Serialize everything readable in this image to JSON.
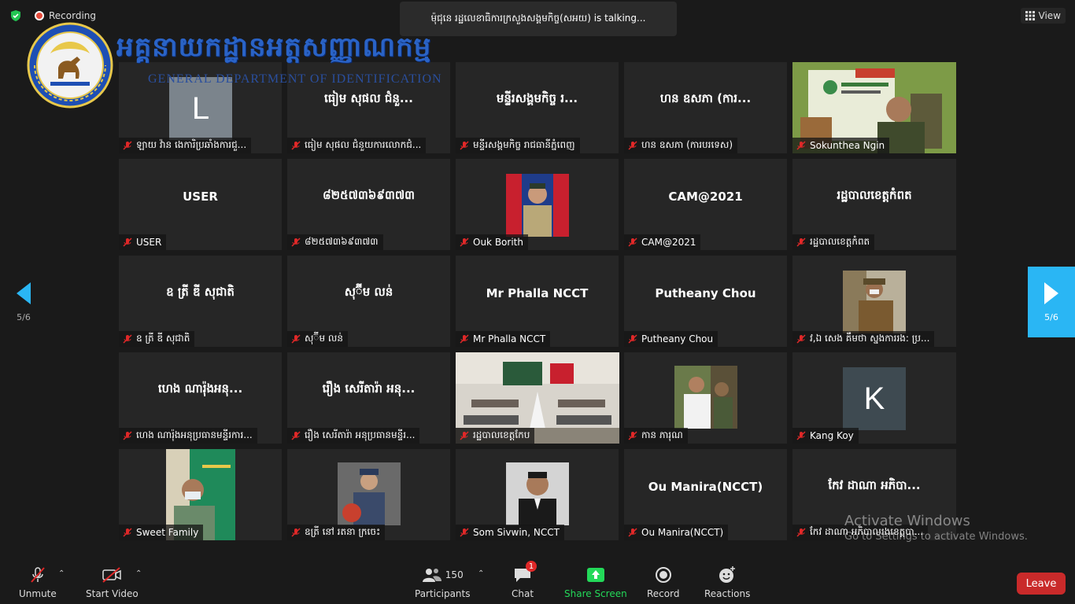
{
  "header": {
    "recording_label": "Recording",
    "talking_text": "ម៉ុជុនេ រដ្ឋលេខាធិការក្រសួងសង្គមកិច្ច(សអយ) is  talking...",
    "view_label": "View"
  },
  "watermark": {
    "khmer_title": "អគ្គនាយកដ្ឋានអត្តសញ្ញាណកម្ម",
    "english_title": "GENERAL DEPARTMENT OF IDENTIFICATION"
  },
  "tiles": [
    {
      "center": "",
      "letter": "L",
      "label": "ឡាយ វ៉ាន ងេការិប្រឆាំងការជួ..."
    },
    {
      "center": "ធៀម សុផល ជំនួ...",
      "label": "ធៀម សុផល ជំនួយការលោកជំ..."
    },
    {
      "center": "មន្ទីរសង្គមកិច្ច រ...",
      "label": "មន្ទីរសង្គមកិច្ច រាជធានីភ្នំពេញ"
    },
    {
      "center": "ហន ឧសភា (ការ...",
      "label": "ហន ឧសភា (ការបរទេស)"
    },
    {
      "center": "",
      "photo": "sokunthea",
      "label": "Sokunthea Ngin"
    },
    {
      "center": "USER",
      "label": "USER"
    },
    {
      "center": "៨២៥៧៣៦៩៣៧៣",
      "label": "៨២៥៧៣៦៩៣៧៣"
    },
    {
      "center": "",
      "photo": "ouk",
      "label": "Ouk Borith"
    },
    {
      "center": "CAM@2021",
      "label": "CAM@2021"
    },
    {
      "center": "រដ្ឋបាលខេត្តកំពត",
      "label": "រដ្ឋបាលខេត្តកំពត"
    },
    {
      "center": "ឧ ត្រី ឌី សុជាតិ",
      "label": "ឧ ត្រី ឌី សុជាតិ"
    },
    {
      "center": "សុ៊ីម លន់",
      "label": "សុ៊ីម លន់"
    },
    {
      "center": "Mr Phalla NCCT",
      "label": "Mr Phalla NCCT"
    },
    {
      "center": "Putheany Chou",
      "label": "Putheany Chou"
    },
    {
      "center": "",
      "photo": "officer",
      "label": "វ,ឯ សេង គឹមថា ស្នងការរង: ប្រ..."
    },
    {
      "center": "ហេង ណារ៉ុងអនុ...",
      "label": "ហេង ណារ៉ុងអនុប្រធានមន្ទីរការ..."
    },
    {
      "center": "រឿង សេរីតារ៉ា អនុ...",
      "label": "រឿង សេរីតារ៉ា អនុប្រធានមន្ទីរ..."
    },
    {
      "center": "",
      "photo": "room",
      "label": "រដ្ឋបាលខេត្តកែប"
    },
    {
      "center": "",
      "photo": "man",
      "label": "កាន ភារុណ"
    },
    {
      "center": "",
      "letter": "K",
      "label": "Kang Koy"
    },
    {
      "center": "",
      "photo": "sweet",
      "label": "Sweet Family"
    },
    {
      "center": "",
      "photo": "woman",
      "label": "ឧត្រី នៅ រតនា ក្រចេះ"
    },
    {
      "center": "",
      "photo": "som",
      "label": "Som Sivwin, NCCT"
    },
    {
      "center": "Ou Manira(NCCT)",
      "label": "Ou Manira(NCCT)"
    },
    {
      "center": "កែវ ដាណា អភិបា...",
      "label": "កែវ ដាណា អភិបាលរងខេត្តបា..."
    }
  ],
  "pagination": {
    "left": "5/6",
    "right": "5/6"
  },
  "activate": {
    "title": "Activate Windows",
    "subtitle": "Go to Settings to activate Windows."
  },
  "toolbar": {
    "unmute": "Unmute",
    "start_video": "Start Video",
    "participants": "Participants",
    "participant_count": "150",
    "chat": "Chat",
    "chat_badge": "1",
    "share_screen": "Share Screen",
    "record": "Record",
    "reactions": "Reactions",
    "leave": "Leave"
  },
  "colors": {
    "accent": "#2ab6f4",
    "leave": "#c92a2a",
    "share": "#23d959",
    "mute": "#e02828"
  }
}
